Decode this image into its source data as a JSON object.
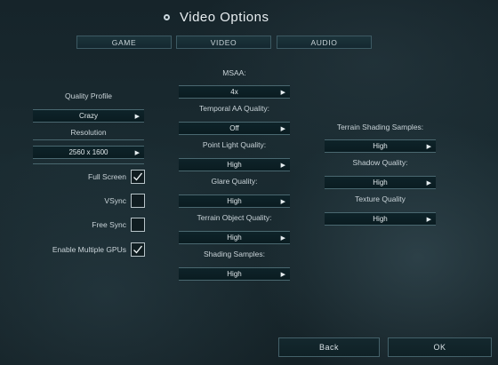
{
  "header": {
    "title": "Video Options"
  },
  "tabs": [
    "GAME",
    "VIDEO",
    "AUDIO"
  ],
  "left": {
    "quality_profile": {
      "label": "Quality Profile",
      "value": "Crazy"
    },
    "resolution": {
      "label": "Resolution",
      "value": "2560 x 1600"
    },
    "checkboxes": [
      {
        "label": "Full Screen",
        "checked": true
      },
      {
        "label": "VSync",
        "checked": false
      },
      {
        "label": "Free Sync",
        "checked": false
      },
      {
        "label": "Enable Multiple GPUs",
        "checked": true
      }
    ]
  },
  "middle": [
    {
      "label": "MSAA:",
      "value": "4x"
    },
    {
      "label": "Temporal AA Quality:",
      "value": "Off"
    },
    {
      "label": "Point Light Quality:",
      "value": "High"
    },
    {
      "label": "Glare Quality:",
      "value": "High"
    },
    {
      "label": "Terrain Object Quality:",
      "value": "High"
    },
    {
      "label": "Shading Samples:",
      "value": "High"
    }
  ],
  "right": [
    {
      "label": "Terrain Shading Samples:",
      "value": "High"
    },
    {
      "label": "Shadow Quality:",
      "value": "High"
    },
    {
      "label": "Texture Quality",
      "value": "High"
    }
  ],
  "footer": {
    "back": "Back",
    "ok": "OK"
  },
  "icons": {
    "dropdown": "triangle-right-icon",
    "check": "checkmark-icon",
    "title": "ring-icon"
  }
}
